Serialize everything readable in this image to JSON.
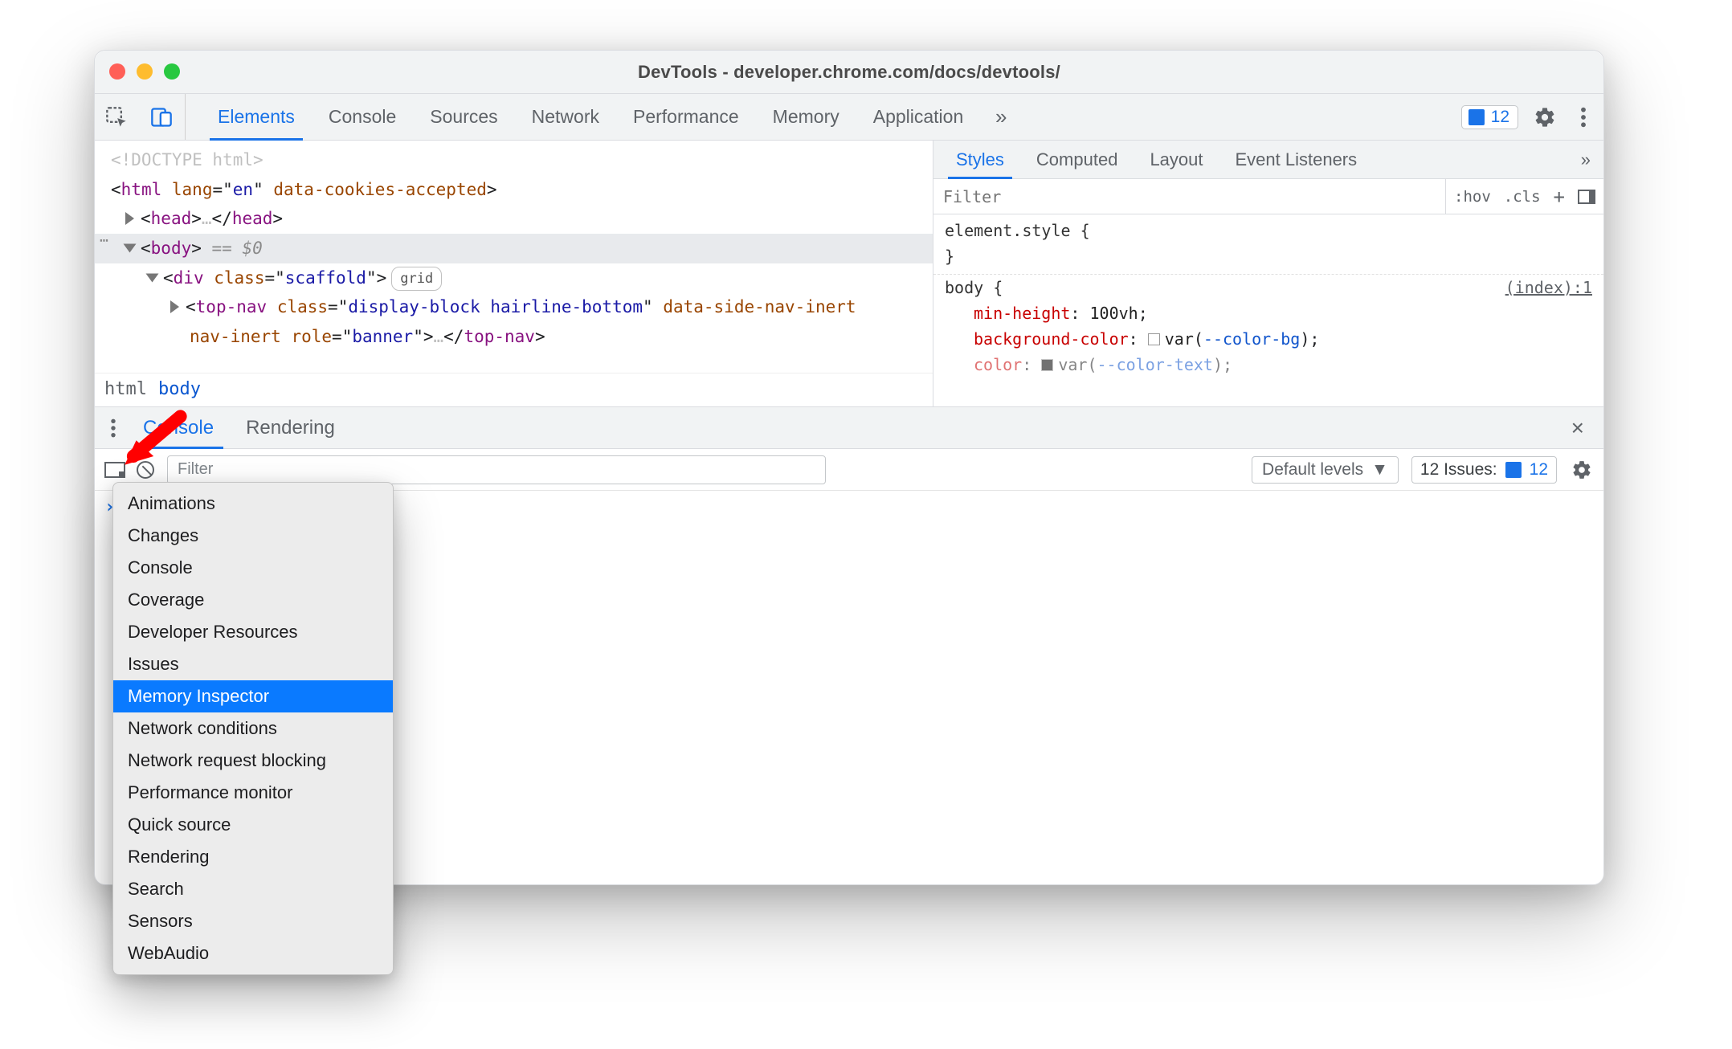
{
  "window": {
    "title": "DevTools - developer.chrome.com/docs/devtools/"
  },
  "toolbar": {
    "tabs": [
      "Elements",
      "Console",
      "Sources",
      "Network",
      "Performance",
      "Memory",
      "Application"
    ],
    "active_tab": "Elements",
    "overflow_glyph": "»",
    "issues_count": "12"
  },
  "dom": {
    "lines": {
      "doctype": "<!DOCTYPE html>",
      "html_open_tag": "html",
      "html_attrs": [
        [
          "lang",
          "en"
        ],
        [
          "data-cookies-accepted",
          ""
        ]
      ],
      "head_summary_open": "head",
      "head_summary_ellipsis": "…",
      "head_summary_close": "head",
      "body_open": "body",
      "body_suffix": " == $0",
      "div_class": "scaffold",
      "grid_chip": "grid",
      "topnav_tag": "top-nav",
      "topnav_class": "display-block hairline-bottom",
      "topnav_attr1": "data-side-nav-inert",
      "topnav_role": "banner",
      "topnav_ellipsis": "…"
    },
    "breadcrumbs": [
      "html",
      "body"
    ]
  },
  "styles": {
    "tabs": [
      "Styles",
      "Computed",
      "Layout",
      "Event Listeners"
    ],
    "active_tab": "Styles",
    "overflow_glyph": "»",
    "filter_placeholder": "Filter",
    "toggles": {
      "hov": ":hov",
      "cls": ".cls",
      "plus": "+"
    },
    "rules": {
      "element_style_label": "element.style {",
      "element_style_close": "}",
      "body_selector": "body {",
      "body_source": "(index):1",
      "props": [
        {
          "k": "min-height",
          "v": "100vh",
          "swatch": null,
          "var": null
        },
        {
          "k": "background-color",
          "v": "var",
          "swatch": "white",
          "var": "--color-bg"
        },
        {
          "k": "color",
          "v": "var",
          "swatch": "black",
          "var": "--color-text"
        }
      ]
    }
  },
  "drawer": {
    "tabs": [
      "Console",
      "Rendering"
    ],
    "active_tab": "Console",
    "close_glyph": "×",
    "console_toolbar": {
      "filter_placeholder": "Filter",
      "levels_label": "Default levels",
      "issues_label": "12 Issues:",
      "issues_count": "12"
    },
    "prompt": "›"
  },
  "menu": {
    "items": [
      "Animations",
      "Changes",
      "Console",
      "Coverage",
      "Developer Resources",
      "Issues",
      "Memory Inspector",
      "Network conditions",
      "Network request blocking",
      "Performance monitor",
      "Quick source",
      "Rendering",
      "Search",
      "Sensors",
      "WebAudio"
    ],
    "highlighted": "Memory Inspector"
  }
}
